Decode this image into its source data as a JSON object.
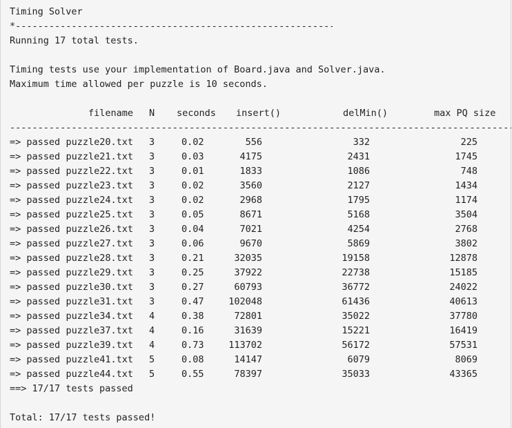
{
  "title": "Timing Solver",
  "title_rule": "*-----------------------------------------------------------",
  "intro": "Running 17 total tests.",
  "notes": [
    "Timing tests use your implementation of Board.java and Solver.java.",
    "Maximum time allowed per puzzle is 10 seconds."
  ],
  "headers": {
    "filename": "filename",
    "n": "N",
    "seconds": "seconds",
    "insert": "insert()",
    "delmin": "delMin()",
    "maxpq": "max PQ size"
  },
  "divider": "------------------------------------------------------------------------------------------------",
  "rows": [
    {
      "status": "=> passed",
      "file": "puzzle20.txt",
      "n": "3",
      "seconds": "0.02",
      "insert": "556",
      "delmin": "332",
      "maxpq": "225"
    },
    {
      "status": "=> passed",
      "file": "puzzle21.txt",
      "n": "3",
      "seconds": "0.03",
      "insert": "4175",
      "delmin": "2431",
      "maxpq": "1745"
    },
    {
      "status": "=> passed",
      "file": "puzzle22.txt",
      "n": "3",
      "seconds": "0.01",
      "insert": "1833",
      "delmin": "1086",
      "maxpq": "748"
    },
    {
      "status": "=> passed",
      "file": "puzzle23.txt",
      "n": "3",
      "seconds": "0.02",
      "insert": "3560",
      "delmin": "2127",
      "maxpq": "1434"
    },
    {
      "status": "=> passed",
      "file": "puzzle24.txt",
      "n": "3",
      "seconds": "0.02",
      "insert": "2968",
      "delmin": "1795",
      "maxpq": "1174"
    },
    {
      "status": "=> passed",
      "file": "puzzle25.txt",
      "n": "3",
      "seconds": "0.05",
      "insert": "8671",
      "delmin": "5168",
      "maxpq": "3504"
    },
    {
      "status": "=> passed",
      "file": "puzzle26.txt",
      "n": "3",
      "seconds": "0.04",
      "insert": "7021",
      "delmin": "4254",
      "maxpq": "2768"
    },
    {
      "status": "=> passed",
      "file": "puzzle27.txt",
      "n": "3",
      "seconds": "0.06",
      "insert": "9670",
      "delmin": "5869",
      "maxpq": "3802"
    },
    {
      "status": "=> passed",
      "file": "puzzle28.txt",
      "n": "3",
      "seconds": "0.21",
      "insert": "32035",
      "delmin": "19158",
      "maxpq": "12878"
    },
    {
      "status": "=> passed",
      "file": "puzzle29.txt",
      "n": "3",
      "seconds": "0.25",
      "insert": "37922",
      "delmin": "22738",
      "maxpq": "15185"
    },
    {
      "status": "=> passed",
      "file": "puzzle30.txt",
      "n": "3",
      "seconds": "0.27",
      "insert": "60793",
      "delmin": "36772",
      "maxpq": "24022"
    },
    {
      "status": "=> passed",
      "file": "puzzle31.txt",
      "n": "3",
      "seconds": "0.47",
      "insert": "102048",
      "delmin": "61436",
      "maxpq": "40613"
    },
    {
      "status": "=> passed",
      "file": "puzzle34.txt",
      "n": "4",
      "seconds": "0.38",
      "insert": "72801",
      "delmin": "35022",
      "maxpq": "37780"
    },
    {
      "status": "=> passed",
      "file": "puzzle37.txt",
      "n": "4",
      "seconds": "0.16",
      "insert": "31639",
      "delmin": "15221",
      "maxpq": "16419"
    },
    {
      "status": "=> passed",
      "file": "puzzle39.txt",
      "n": "4",
      "seconds": "0.73",
      "insert": "113702",
      "delmin": "56172",
      "maxpq": "57531"
    },
    {
      "status": "=> passed",
      "file": "puzzle41.txt",
      "n": "5",
      "seconds": "0.08",
      "insert": "14147",
      "delmin": "6079",
      "maxpq": "8069"
    },
    {
      "status": "=> passed",
      "file": "puzzle44.txt",
      "n": "5",
      "seconds": "0.55",
      "insert": "78397",
      "delmin": "35033",
      "maxpq": "43365"
    }
  ],
  "summary": "==> 17/17 tests passed",
  "total": "Total: 17/17 tests passed!"
}
